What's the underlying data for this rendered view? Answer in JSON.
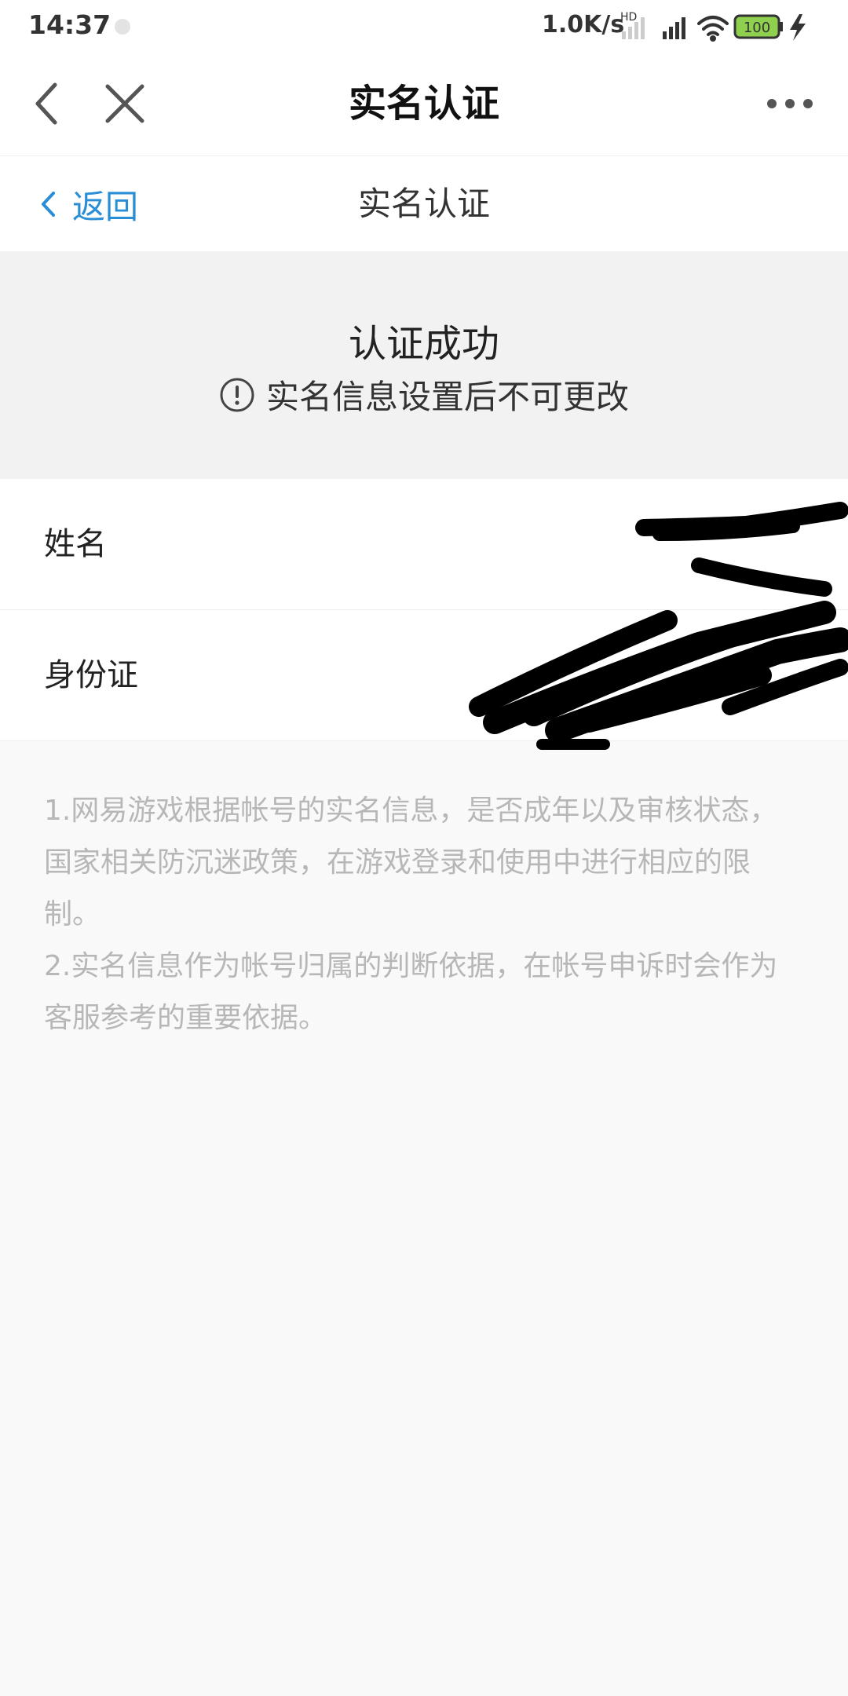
{
  "status_bar": {
    "time": "14:37",
    "network_speed": "1.0K/s",
    "network_type": "HD",
    "battery_level": "100",
    "icons": [
      "signal-hd-icon",
      "signal-icon",
      "wifi-icon",
      "battery-icon",
      "charging-icon"
    ]
  },
  "app_bar": {
    "title": "实名认证",
    "icons": [
      "back-arrow-icon",
      "close-icon",
      "more-icon"
    ]
  },
  "nav_bar": {
    "back_label": "返回",
    "title": "实名认证"
  },
  "success": {
    "title": "认证成功",
    "note": "实名信息设置后不可更改"
  },
  "info_rows": [
    {
      "label": "姓名"
    },
    {
      "label": "身份证"
    }
  ],
  "notes": [
    "1.网易游戏根据帐号的实名信息，是否成年以及审核状态，国家相关防沉迷政策，在游戏登录和使用中进行相应的限制。",
    "2.实名信息作为帐号归属的判断依据，在帐号申诉时会作为客服参考的重要依据。"
  ],
  "colors": {
    "link_blue": "#2a8ed6",
    "battery_green": "#8fd14f",
    "note_gray": "#b7b7b7",
    "redaction_black": "#000000"
  }
}
